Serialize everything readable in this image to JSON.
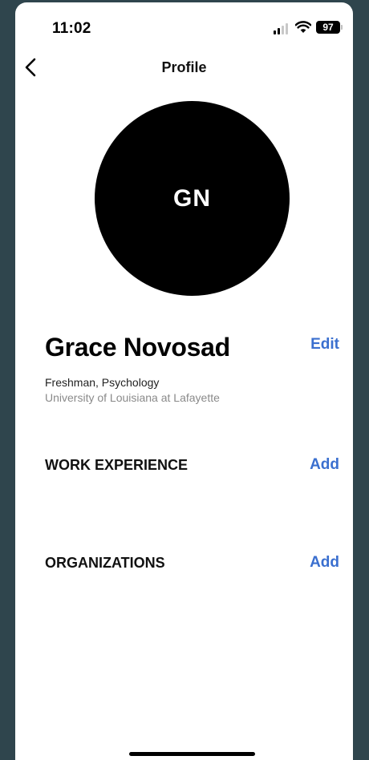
{
  "status_bar": {
    "time": "11:02",
    "battery": "97"
  },
  "nav": {
    "title": "Profile"
  },
  "profile": {
    "initials": "GN",
    "name": "Grace Novosad",
    "edit_label": "Edit",
    "year_major": "Freshman, Psychology",
    "school": "University of Louisiana at Lafayette"
  },
  "sections": {
    "work_experience": {
      "heading": "WORK EXPERIENCE",
      "add_label": "Add"
    },
    "organizations": {
      "heading": "ORGANIZATIONS",
      "add_label": "Add"
    }
  },
  "colors": {
    "accent": "#3a6fcf",
    "backdrop": "#2f454d",
    "avatar": "#000000"
  },
  "icons": [
    "chevron-left-icon",
    "signal-icon",
    "wifi-icon",
    "battery-icon"
  ]
}
